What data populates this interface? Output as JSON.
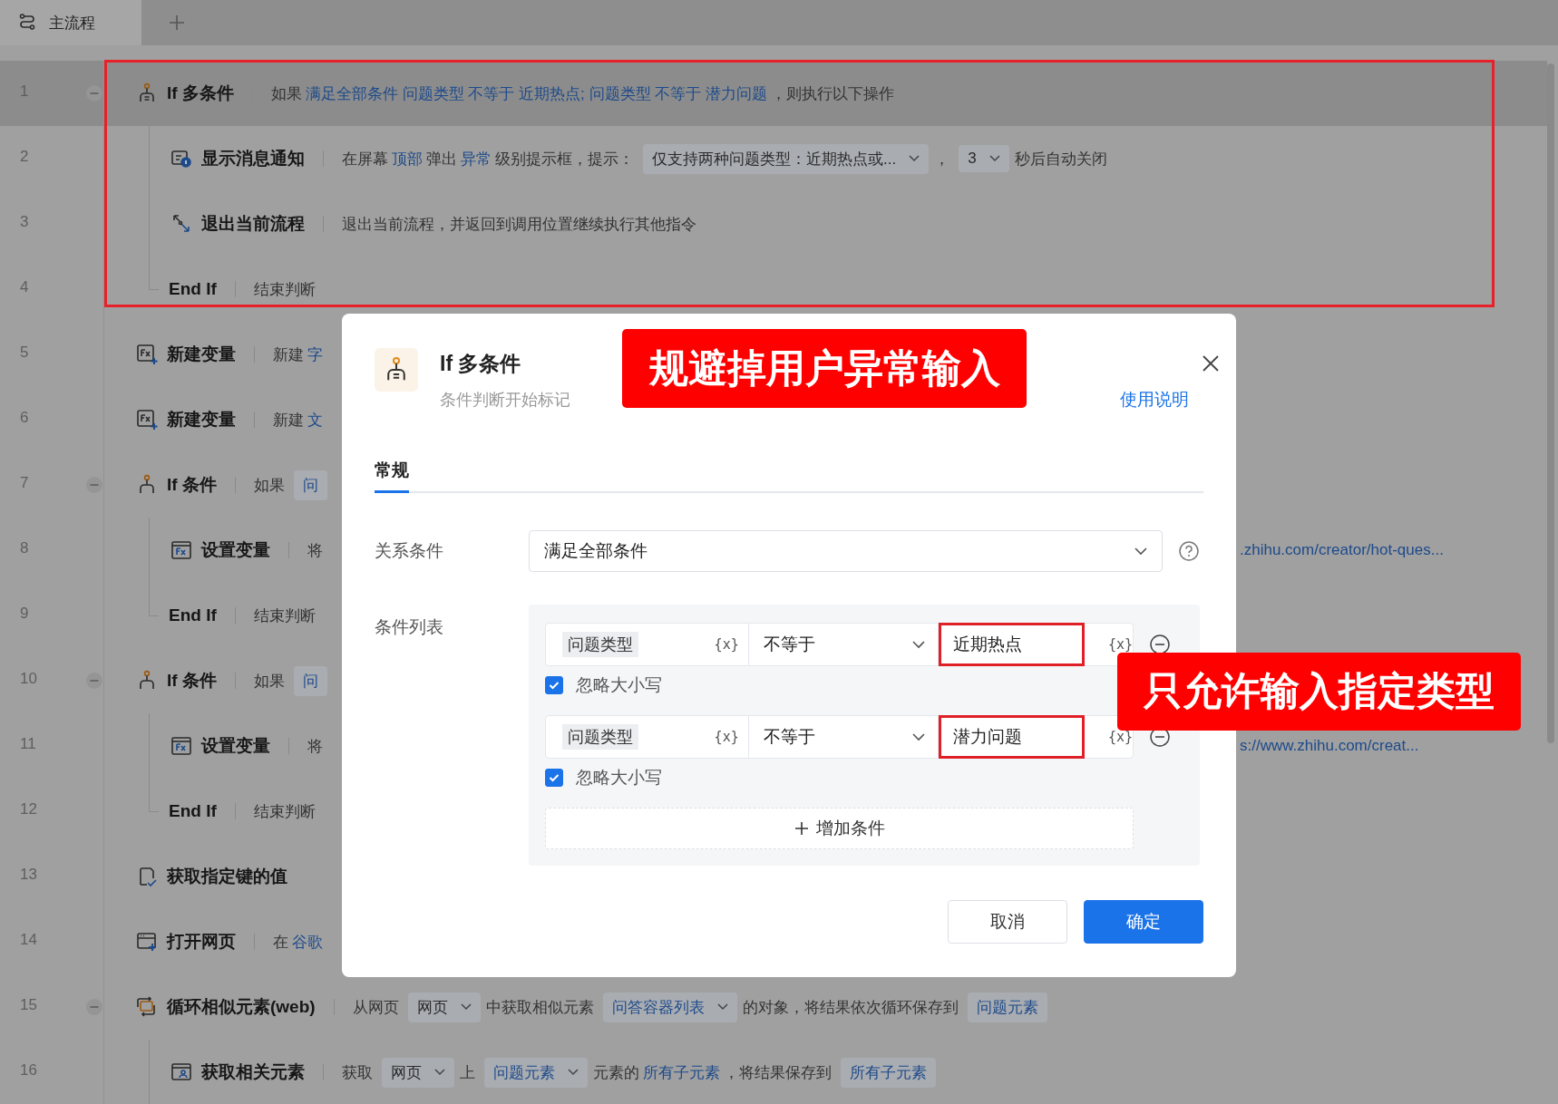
{
  "tabs": [
    {
      "label": "主流程",
      "selected": true
    }
  ],
  "rows": [
    {
      "number": "1",
      "kind": "if-multi",
      "title": "If 多条件",
      "selected": true,
      "expanded": true,
      "segments": [
        {
          "kind": "text",
          "text": "如果"
        },
        {
          "kind": "link",
          "text": "满足全部条件 问题类型 不等于 近期热点; 问题类型 不等于 潜力问题"
        },
        {
          "kind": "text",
          "text": "，则执行以下操作"
        }
      ],
      "children": [
        {
          "number": "2",
          "kind": "notify",
          "title": "显示消息通知",
          "selected": false,
          "segments": [
            {
              "kind": "text",
              "text": "在屏幕"
            },
            {
              "kind": "link",
              "text": "顶部"
            },
            {
              "kind": "text",
              "text": "弹出"
            },
            {
              "kind": "link",
              "text": "异常"
            },
            {
              "kind": "text",
              "text": "级别提示框，提示："
            },
            {
              "kind": "select",
              "text": "仅支持两种问题类型：近期热点或..."
            },
            {
              "kind": "text",
              "text": "，"
            },
            {
              "kind": "select",
              "text": "3"
            },
            {
              "kind": "text",
              "text": "秒后自动关闭"
            }
          ]
        },
        {
          "number": "3",
          "kind": "exit",
          "title": "退出当前流程",
          "selected": false,
          "segments": [
            {
              "kind": "text",
              "text": "退出当前流程，并返回到调用位置继续执行其他指令"
            }
          ]
        },
        {
          "number": "4",
          "kind": "end",
          "title": "End If",
          "selected": false,
          "segments": [
            {
              "kind": "text",
              "text": "结束判断"
            }
          ]
        }
      ]
    },
    {
      "number": "5",
      "kind": "new-var",
      "title": "新建变量",
      "selected": false,
      "segments": [
        {
          "kind": "text",
          "text": "新建"
        },
        {
          "kind": "link",
          "text": "字"
        }
      ]
    },
    {
      "number": "6",
      "kind": "new-var",
      "title": "新建变量",
      "selected": false,
      "segments": [
        {
          "kind": "text",
          "text": "新建"
        },
        {
          "kind": "link",
          "text": "文"
        }
      ]
    },
    {
      "number": "7",
      "kind": "if",
      "title": "If 条件",
      "selected": false,
      "expanded": true,
      "segments": [
        {
          "kind": "text",
          "text": "如果"
        },
        {
          "kind": "token",
          "text": "问"
        }
      ],
      "children": [
        {
          "number": "8",
          "kind": "set-var",
          "title": "设置变量",
          "selected": false,
          "segments": [
            {
              "kind": "text",
              "text": "将"
            }
          ],
          "tail": ".zhihu.com/creator/hot-ques..."
        },
        {
          "number": "9",
          "kind": "end",
          "title": "End If",
          "selected": false,
          "segments": [
            {
              "kind": "text",
              "text": "结束判断"
            }
          ]
        }
      ]
    },
    {
      "number": "10",
      "kind": "if",
      "title": "If 条件",
      "selected": false,
      "expanded": true,
      "segments": [
        {
          "kind": "text",
          "text": "如果"
        },
        {
          "kind": "token",
          "text": "问"
        }
      ],
      "children": [
        {
          "number": "11",
          "kind": "set-var",
          "title": "设置变量",
          "selected": false,
          "segments": [
            {
              "kind": "text",
              "text": "将"
            }
          ],
          "tail": "s://www.zhihu.com/creat..."
        },
        {
          "number": "12",
          "kind": "end",
          "title": "End If",
          "selected": false,
          "segments": [
            {
              "kind": "text",
              "text": "结束判断"
            }
          ]
        }
      ]
    },
    {
      "number": "13",
      "kind": "get-key",
      "title": "获取指定键的值",
      "selected": false,
      "segments": []
    },
    {
      "number": "14",
      "kind": "open-web",
      "title": "打开网页",
      "selected": false,
      "segments": [
        {
          "kind": "text",
          "text": "在"
        },
        {
          "kind": "link",
          "text": "谷歌"
        }
      ]
    },
    {
      "number": "15",
      "kind": "loop",
      "title": "循环相似元素(web)",
      "selected": false,
      "expanded": true,
      "segments": [
        {
          "kind": "text",
          "text": "从网页"
        },
        {
          "kind": "select",
          "text": "网页"
        },
        {
          "kind": "text",
          "text": "中获取相似元素"
        },
        {
          "kind": "token-select",
          "text": "问答容器列表"
        },
        {
          "kind": "text",
          "text": "的对象，将结果依次循环保存到"
        },
        {
          "kind": "token",
          "text": "问题元素"
        }
      ],
      "children": [
        {
          "number": "16",
          "kind": "get-element",
          "title": "获取相关元素",
          "selected": false,
          "segments": [
            {
              "kind": "text",
              "text": "获取"
            },
            {
              "kind": "select",
              "text": "网页"
            },
            {
              "kind": "text",
              "text": "上"
            },
            {
              "kind": "token-select",
              "text": "问题元素"
            },
            {
              "kind": "text",
              "text": "元素的"
            },
            {
              "kind": "link",
              "text": "所有子元素"
            },
            {
              "kind": "text",
              "text": "，将结果保存到"
            },
            {
              "kind": "token",
              "text": "所有子元素"
            }
          ]
        }
      ]
    }
  ],
  "dialog": {
    "title": "If 多条件",
    "subtitle": "条件判断开始标记",
    "help_link": "使用说明",
    "tabs": [
      {
        "label": "常规",
        "selected": true
      }
    ],
    "relation": {
      "label": "关系条件",
      "value": "满足全部条件"
    },
    "conditions_label": "条件列表",
    "conditions": [
      {
        "variable": "问题类型",
        "variable_button": "{x}",
        "operator": "不等于",
        "value": "近期热点",
        "value_button": "{x}",
        "highlighted": true,
        "ignore_case": {
          "label": "忽略大小写",
          "checked": true
        }
      },
      {
        "variable": "问题类型",
        "variable_button": "{x}",
        "operator": "不等于",
        "value": "潜力问题",
        "value_button": "{x}",
        "highlighted": true,
        "ignore_case": {
          "label": "忽略大小写",
          "checked": true
        }
      }
    ],
    "add_condition": "增加条件",
    "buttons": [
      {
        "label": "取消",
        "kind": "secondary"
      },
      {
        "label": "确定",
        "kind": "primary"
      }
    ]
  },
  "annotations": [
    {
      "kind": "frame"
    },
    {
      "kind": "label",
      "text": "规避掉用户异常输入"
    },
    {
      "kind": "label",
      "text": "只允许输入指定类型"
    }
  ]
}
